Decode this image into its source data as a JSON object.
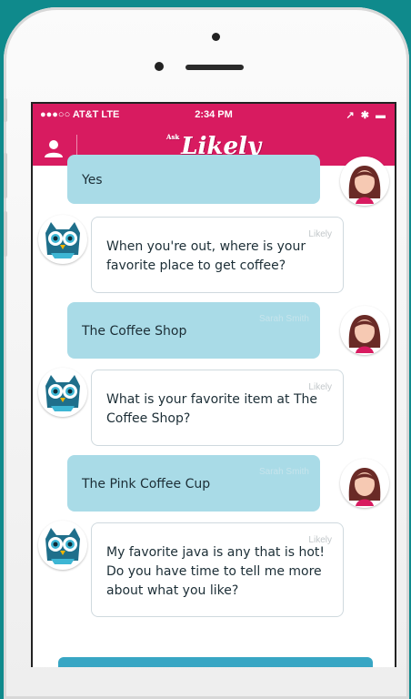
{
  "status": {
    "carrier": "●●●○○ AT&T  LTE",
    "time": "2:34 PM",
    "right": "↗ ✱ ▬"
  },
  "app": {
    "logo_small": "Ask",
    "logo": "Likely"
  },
  "messages": [
    {
      "from": "user",
      "sender": "",
      "text": "Yes"
    },
    {
      "from": "bot",
      "sender": "Likely",
      "text": "When you're out, where is your favorite place to get coffee?"
    },
    {
      "from": "user",
      "sender": "Sarah Smith",
      "text": "The Coffee Shop"
    },
    {
      "from": "bot",
      "sender": "Likely",
      "text": "What is your favorite item at The Coffee Shop?"
    },
    {
      "from": "user",
      "sender": "Sarah Smith",
      "text": "The Pink Coffee Cup"
    },
    {
      "from": "bot",
      "sender": "Likely",
      "text": "My favorite java is any that is hot! Do you have time to tell me more about what you like?"
    }
  ],
  "colors": {
    "brand": "#d81b60",
    "user_bubble": "#a9dbe7",
    "background": "#0f8a8c"
  },
  "icons": [
    "user-icon",
    "owl-avatar-icon",
    "woman-avatar-icon"
  ]
}
